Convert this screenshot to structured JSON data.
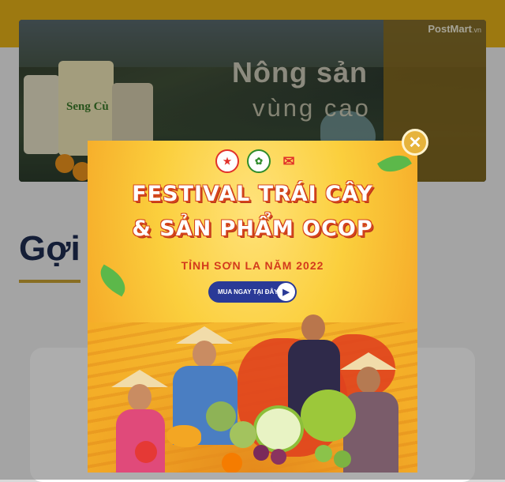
{
  "hero": {
    "title": "Nông sản",
    "subtitle": "vùng cao",
    "brand": "PostMart",
    "brand_suffix": ".vn",
    "product_label": "Seng Cù"
  },
  "section": {
    "title": "Gợi"
  },
  "popup": {
    "headline_line1": "FESTIVAL TRÁI CÂY",
    "headline_line2": "& SẢN PHẨM OCOP",
    "subtitle": "TỈNH SƠN LA NĂM 2022",
    "cta_label": "MUA NGAY TẠI ĐÂY",
    "logos": [
      "Tỉnh Sơn La",
      "Hội Nông Dân Việt Nam",
      "Vietnam Post"
    ],
    "close_icon": "close-icon"
  },
  "colors": {
    "accent": "#e8b319",
    "headline_outline": "#d6451c",
    "cta_bg": "#2a3a97",
    "section_title": "#1e2d52"
  }
}
